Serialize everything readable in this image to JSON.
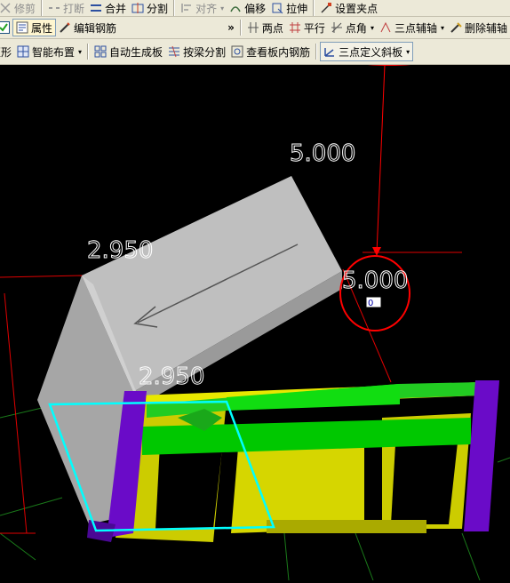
{
  "toolbar1": {
    "trim": "修剪",
    "break": "打断",
    "merge": "合并",
    "split": "分割",
    "align": "对齐",
    "offset": "偏移",
    "stretch": "拉伸",
    "set_grip": "设置夹点"
  },
  "toolbar2": {
    "properties": "属性",
    "edit_rebar": "编辑钢筋",
    "overflow": "»",
    "two_point": "两点",
    "parallel": "平行",
    "point_angle": "点角",
    "three_point_axis": "三点辅轴",
    "delete_axis": "删除辅轴"
  },
  "toolbar3": {
    "rect": "矩形",
    "smart_layout": "智能布置",
    "auto_gen_slab": "自动生成板",
    "split_by_beam": "按梁分割",
    "view_slab_rebar": "查看板内钢筋",
    "three_point_slope": "三点定义斜板"
  },
  "viewport": {
    "dim_top": "5.000",
    "dim_left": "2.950",
    "dim_right": "5.000",
    "dim_bottom": "2.950",
    "input_value": "0"
  },
  "colors": {
    "annotation": "#ff0000",
    "slab": "#b4b4b4",
    "wall": "#dcdc00",
    "beam": "#00d200",
    "column": "#6a0bc8",
    "selection": "#00ffff",
    "dim_text": "#ffffff"
  }
}
